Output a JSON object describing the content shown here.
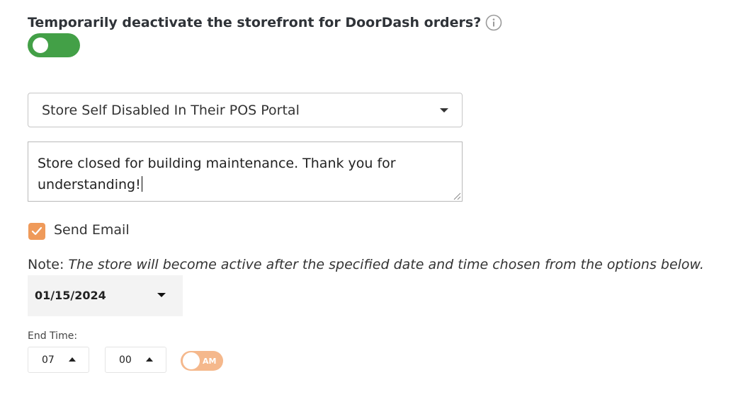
{
  "header": {
    "question": "Temporarily deactivate the storefront for DoorDash orders?",
    "info_icon": "info-icon"
  },
  "deactivate_toggle": {
    "state": "on",
    "color": "#43a047"
  },
  "reason_select": {
    "selected": "Store Self Disabled In Their POS Portal"
  },
  "message": {
    "value": "Store closed for building maintenance. Thank you for understanding!"
  },
  "send_email": {
    "label": "Send Email",
    "checked": true,
    "color": "#ef9a5a"
  },
  "note": {
    "prefix": "Note:",
    "text": "The store will become active after the specified date and time chosen from the options below."
  },
  "date": {
    "value": "01/15/2024"
  },
  "end_time": {
    "label": "End Time:",
    "hour": "07",
    "minute": "00",
    "period": "AM",
    "period_color": "#f5b88c"
  }
}
